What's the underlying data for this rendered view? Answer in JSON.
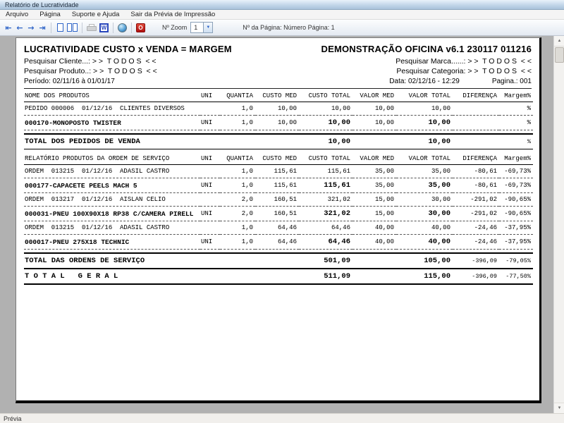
{
  "window": {
    "title": "Relatório de Lucratividade"
  },
  "menu": {
    "items": [
      {
        "label": "Arquivo"
      },
      {
        "label": "Página"
      },
      {
        "label": "Suporte e Ajuda"
      },
      {
        "label": "Sair da Prévia de Impressão"
      }
    ]
  },
  "toolbar": {
    "zoom_label": "Nº Zoom",
    "zoom_value": "1",
    "page_info": "Nº da Página: Número Página: 1",
    "word_icon_letter": "W",
    "exit_icon_letter": "O"
  },
  "colors": {
    "toolbar_icon_blue": "#2e64c8",
    "export_red": "#c11b17",
    "titlebar_top": "#e9f2fa",
    "titlebar_bottom": "#a9c2da",
    "canvas_gray": "#b1b1b1"
  },
  "report": {
    "title": "LUCRATIVIDADE CUSTO x VENDA = MARGEM",
    "app_title": "DEMONSTRAÇÃO OFICINA v6.1 230117 011216",
    "filter_cliente": "Pesquisar Cliente...: > >  T O D O S  < <",
    "filter_produto": "Pesquisar Produto..: > >  T O D O S  < <",
    "filter_marca": "Pesquisar Marca......: > >  T O D O S  < <",
    "filter_categoria": "Pesquisar Categoria: > >  T O D O S  < <",
    "periodo": "Período: 02/11/16 à 01/01/17",
    "data_emissao": "Data: 02/12/16 - 12:29",
    "pagina": "Pagina.: 001",
    "columns": [
      "UNI",
      "QUANTIA",
      "CUSTO MED",
      "CUSTO TOTAL",
      "VALOR MED",
      "VALOR TOTAL",
      "DIFERENÇA",
      "Margem%"
    ],
    "sections": [
      {
        "header": "NOME DOS PRODUTOS",
        "rows": [
          {
            "type": "data",
            "name": "PEDIDO 000006  01/12/16  CLIENTES DIVERSOS",
            "uni": "",
            "qty": "1,0",
            "custo_med": "10,00",
            "custo_total": "10,00",
            "valor_med": "10,00",
            "valor_total": "10,00",
            "diferenca": "",
            "margem": "%",
            "bold": false
          },
          {
            "type": "data",
            "name": "000170-MONOPOSTO TWISTER",
            "uni": "UNI",
            "qty": "1,0",
            "custo_med": "10,00",
            "custo_total": "10,00",
            "valor_med": "10,00",
            "valor_total": "10,00",
            "diferenca": "",
            "margem": "%",
            "bold": true
          },
          {
            "type": "total",
            "name": "TOTAL DOS PEDIDOS DE VENDA",
            "custo_total": "10,00",
            "valor_total": "10,00",
            "diferenca": "",
            "margem": "%"
          }
        ]
      },
      {
        "header": "RELATÓRIO PRODUTOS DA ORDEM DE SERVIÇO",
        "rows": [
          {
            "type": "data",
            "name": "ORDEM  013215  01/12/16  ADASIL CASTRO",
            "uni": "",
            "qty": "1,0",
            "custo_med": "115,61",
            "custo_total": "115,61",
            "valor_med": "35,00",
            "valor_total": "35,00",
            "diferenca": "-80,61",
            "margem": "-69,73%",
            "bold": false
          },
          {
            "type": "data",
            "name": "000177-CAPACETE PEELS MACH 5",
            "uni": "UNI",
            "qty": "1,0",
            "custo_med": "115,61",
            "custo_total": "115,61",
            "valor_med": "35,00",
            "valor_total": "35,00",
            "diferenca": "-80,61",
            "margem": "-69,73%",
            "bold": true
          },
          {
            "type": "data",
            "name": "ORDEM  013217  01/12/16  AISLAN CELIO",
            "uni": "",
            "qty": "2,0",
            "custo_med": "160,51",
            "custo_total": "321,02",
            "valor_med": "15,00",
            "valor_total": "30,00",
            "diferenca": "-291,02",
            "margem": "-90,65%",
            "bold": false
          },
          {
            "type": "data",
            "name": "000031-PNEU 100X90X18 RP38 C/CAMERA PIRELL",
            "uni": "UNI",
            "qty": "2,0",
            "custo_med": "160,51",
            "custo_total": "321,02",
            "valor_med": "15,00",
            "valor_total": "30,00",
            "diferenca": "-291,02",
            "margem": "-90,65%",
            "bold": true
          },
          {
            "type": "data",
            "name": "ORDEM  013215  01/12/16  ADASIL CASTRO",
            "uni": "",
            "qty": "1,0",
            "custo_med": "64,46",
            "custo_total": "64,46",
            "valor_med": "40,00",
            "valor_total": "40,00",
            "diferenca": "-24,46",
            "margem": "-37,95%",
            "bold": false
          },
          {
            "type": "data",
            "name": "000017-PNEU 275X18 TECHNIC",
            "uni": "UNI",
            "qty": "1,0",
            "custo_med": "64,46",
            "custo_total": "64,46",
            "valor_med": "40,00",
            "valor_total": "40,00",
            "diferenca": "-24,46",
            "margem": "-37,95%",
            "bold": true
          },
          {
            "type": "total",
            "name": "TOTAL DAS ORDENS DE SERVIÇO",
            "custo_total": "501,09",
            "valor_total": "105,00",
            "diferenca": "-396,09",
            "margem": "-79,05%"
          },
          {
            "type": "total",
            "name": "T O T A L   G E R A L",
            "custo_total": "511,09",
            "valor_total": "115,00",
            "diferenca": "-396,09",
            "margem": "-77,50%"
          }
        ]
      }
    ]
  },
  "status": {
    "label": "Prévia"
  }
}
